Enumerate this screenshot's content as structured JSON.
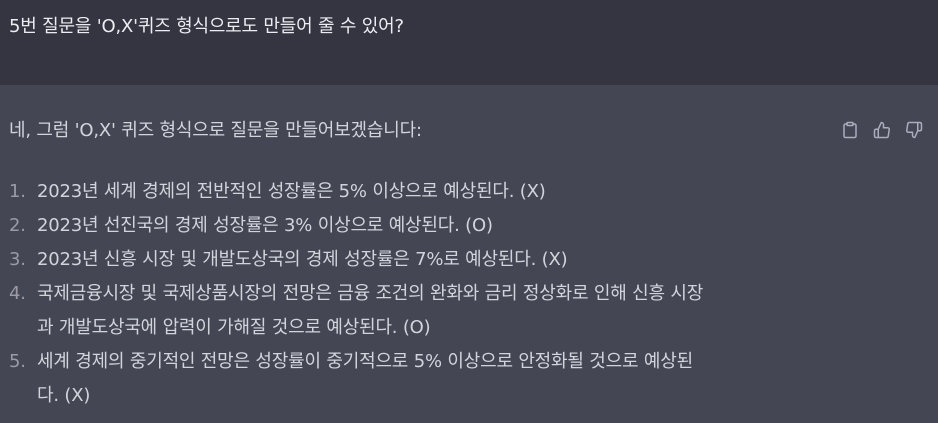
{
  "user_message": {
    "text": "5번 질문을 'O,X'퀴즈 형식으로도 만들어 줄 수 있어?"
  },
  "assistant_message": {
    "intro": "네, 그럼 'O,X' 퀴즈 형식으로 질문을 만들어보겠습니다:",
    "items": [
      {
        "number": "1.",
        "text": "2023년 세계 경제의 전반적인 성장률은 5% 이상으로 예상된다. (X)"
      },
      {
        "number": "2.",
        "text": "2023년 선진국의 경제 성장률은 3% 이상으로 예상된다. (O)"
      },
      {
        "number": "3.",
        "text": "2023년 신흥 시장 및 개발도상국의 경제 성장률은 7%로 예상된다. (X)"
      },
      {
        "number": "4.",
        "line1": "국제금융시장 및 국제상품시장의 전망은 금융 조건의 완화와 금리 정상화로 인해 신흥 시장",
        "line2": "과 개발도상국에 압력이 가해질 것으로 예상된다. (O)"
      },
      {
        "number": "5.",
        "line1": "세계 경제의 중기적인 전망은 성장률이 중기적으로 5% 이상으로 안정화될 것으로 예상된",
        "line2": "다. (X)"
      }
    ]
  },
  "actions": {
    "copy_icon": "clipboard-icon",
    "like_icon": "thumbs-up-icon",
    "dislike_icon": "thumbs-down-icon"
  },
  "colors": {
    "user_bg": "#343541",
    "assistant_bg": "#444654",
    "text": "#d1d5db",
    "icon": "#acacbe"
  }
}
